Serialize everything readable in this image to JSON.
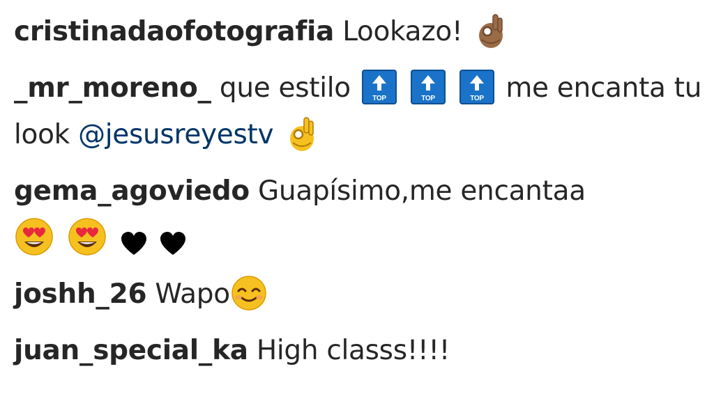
{
  "comments": [
    {
      "username": "cristinadaofotografia",
      "text_1": "Lookazo!",
      "emojis": [
        "ok-hand-icon (medium-dark skin)"
      ]
    },
    {
      "username": "_mr_moreno_",
      "text_1": "que estilo",
      "text_2": "me encanta tu look",
      "mention": "@jesusreyestv",
      "top_badge_label": "TOP",
      "emojis": [
        "top-arrow-icon",
        "top-arrow-icon",
        "top-arrow-icon",
        "ok-hand-icon"
      ]
    },
    {
      "username": "gema_agoviedo",
      "text_1": "Guapísimo,me encantaa",
      "emojis": [
        "heart-eyes-face-icon",
        "heart-eyes-face-icon",
        "black-heart-icon",
        "black-heart-icon"
      ]
    },
    {
      "username": "joshh_26",
      "text_1": "Wapo",
      "emojis": [
        "smiling-face-closed-eyes-icon"
      ]
    },
    {
      "username": "juan_special_ka",
      "text_1": "High classs!!!!",
      "emojis": []
    }
  ],
  "colors": {
    "username": "#262626",
    "text": "#262626",
    "mention": "#003569",
    "badge_blue": "#1a73c9",
    "emoji_yellow": "#f7c021",
    "emoji_skin_dark": "#9a6b47",
    "heart_eyes_red": "#e8283c"
  }
}
